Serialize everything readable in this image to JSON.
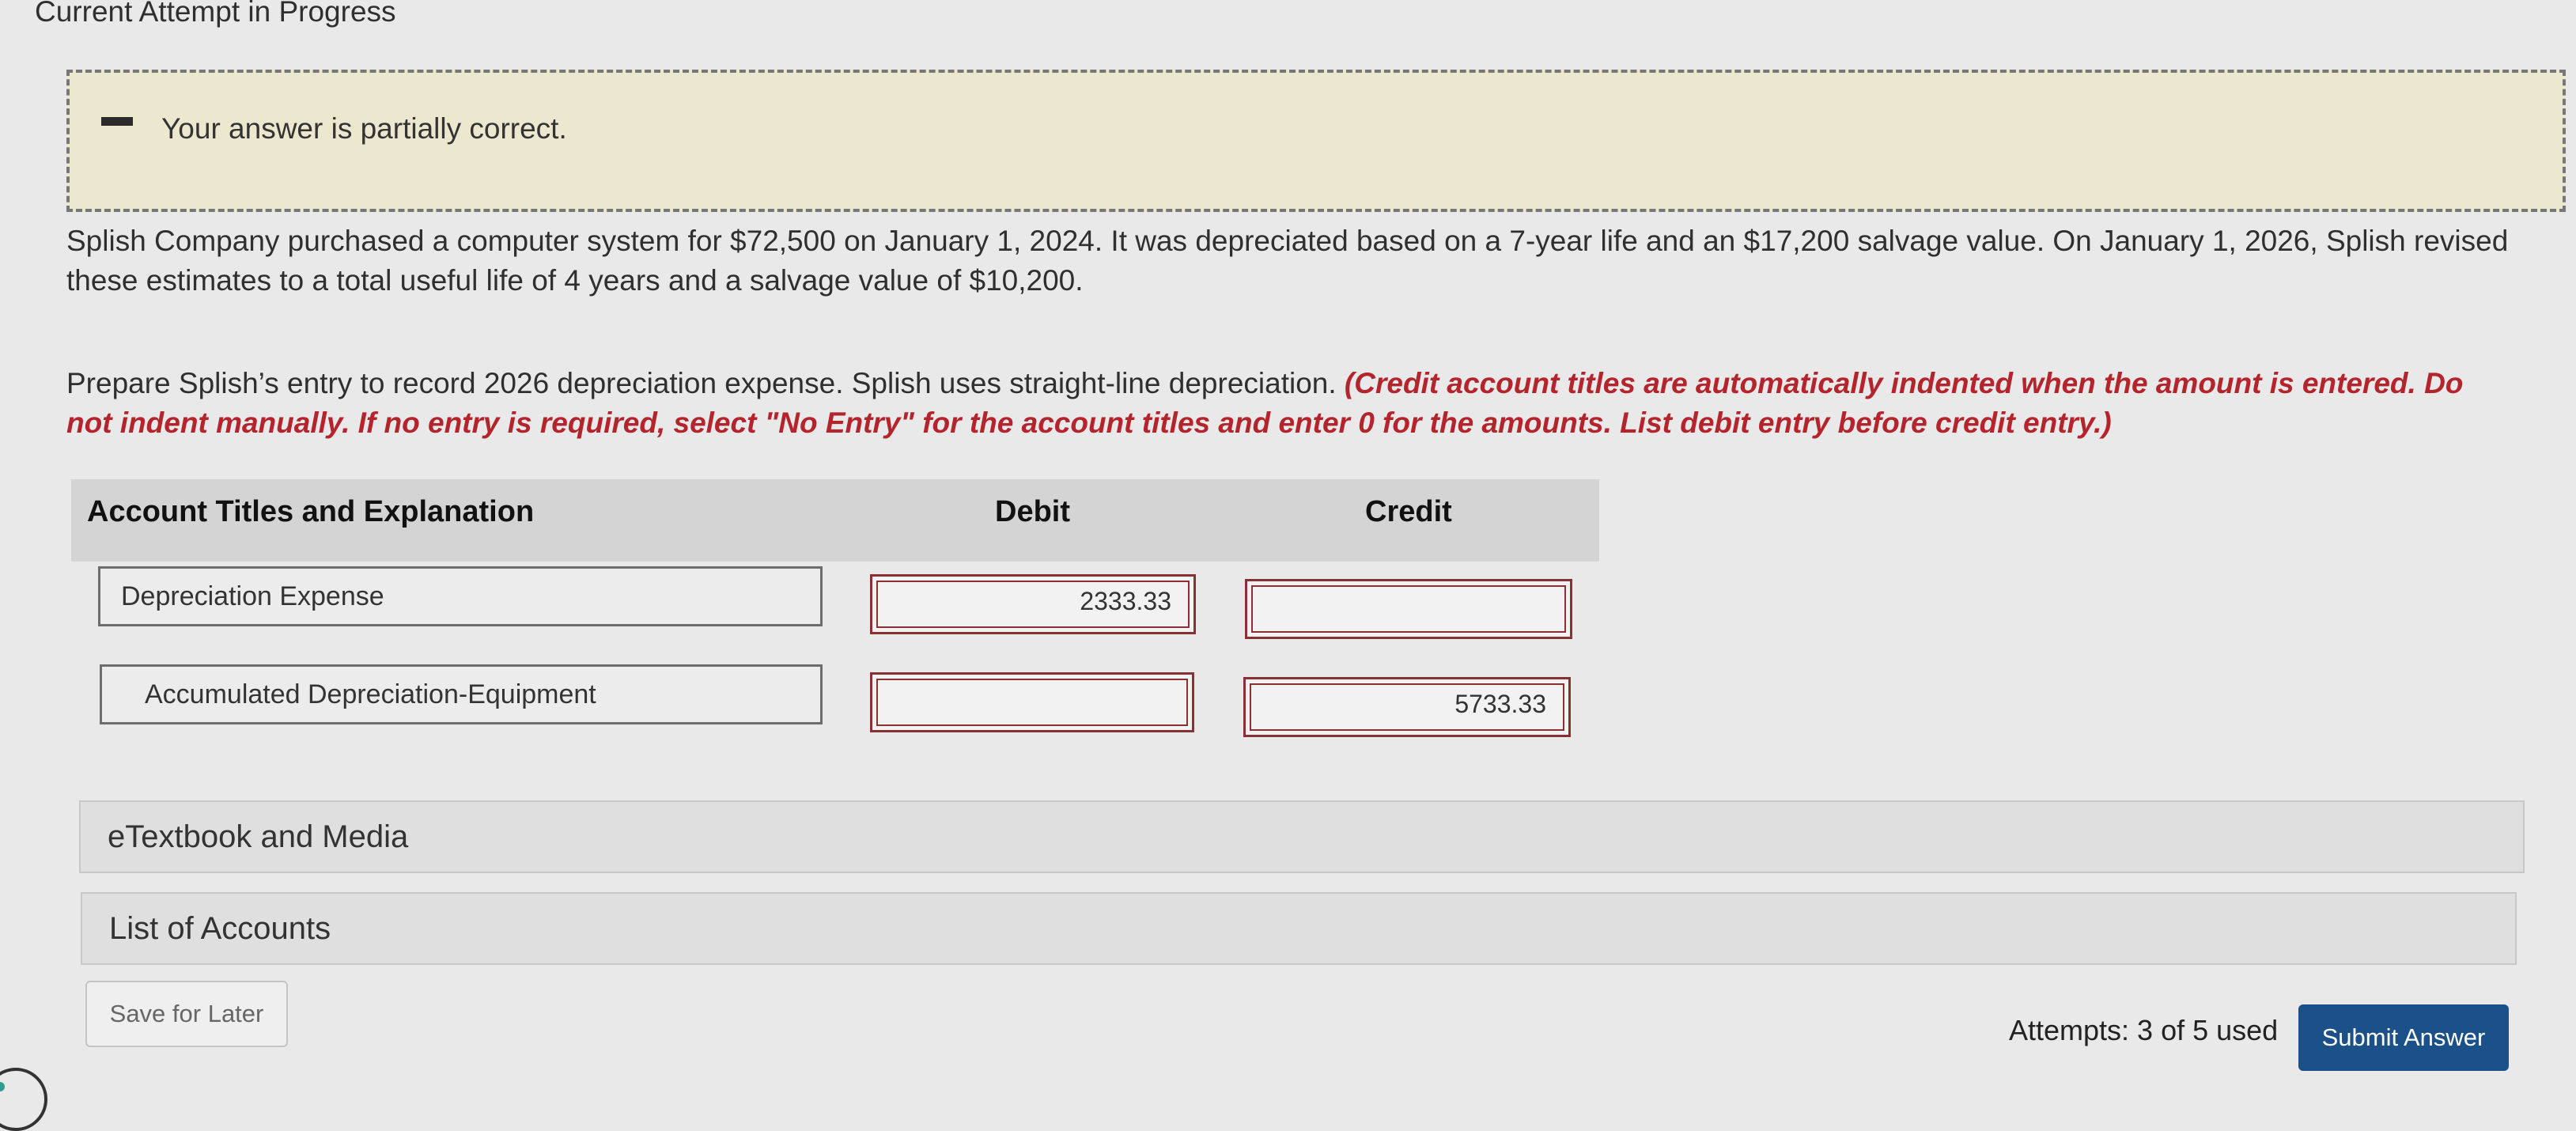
{
  "page": {
    "title": "Current Attempt in Progress"
  },
  "feedback": {
    "text": "Your answer is partially correct."
  },
  "problem": {
    "text": "Splish Company purchased a computer system for $72,500 on January 1, 2024. It was depreciated based on a 7-year life and an $17,200 salvage value. On January 1, 2026, Splish revised these estimates to a total useful life of 4 years and a salvage value of $10,200.",
    "instruction": "Prepare Splish’s entry to record 2026 depreciation expense. Splish uses straight-line depreciation.",
    "note": "(Credit account titles are automatically indented when the amount is entered. Do not indent manually. If no entry is required, select \"No Entry\" for the account titles and enter 0 for the amounts. List debit entry before credit entry.)"
  },
  "table": {
    "headers": {
      "account": "Account Titles and Explanation",
      "debit": "Debit",
      "credit": "Credit"
    },
    "rows": [
      {
        "account": "Depreciation Expense",
        "debit": "2333.33",
        "credit": ""
      },
      {
        "account": "Accumulated Depreciation-Equipment",
        "debit": "",
        "credit": "5733.33"
      }
    ]
  },
  "panels": {
    "etextbook": "eTextbook and Media",
    "accounts": "List of Accounts"
  },
  "footer": {
    "save_label": "Save for Later",
    "attempts": "Attempts: 3 of 5 used",
    "submit_label": "Submit Answer"
  },
  "colors": {
    "accent": "#1b5088",
    "error": "#b3242c",
    "feedback_bg": "#ece8cf"
  }
}
